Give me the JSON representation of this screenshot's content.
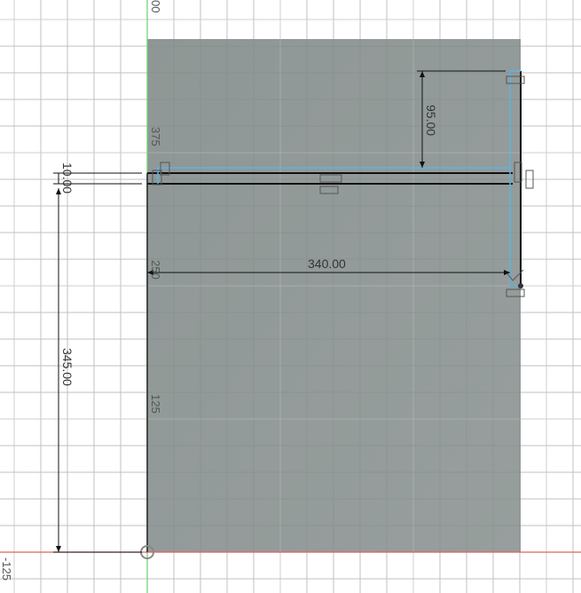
{
  "viewport": {
    "axis_labels": {
      "top": "00",
      "v375": "375",
      "v250": "250",
      "v125": "125",
      "neg125": "-125"
    }
  },
  "dimensions": {
    "thickness": "10.00",
    "offset_top": "95.00",
    "width": "340.00",
    "height": "345.00"
  },
  "colors": {
    "profile": "#929a99",
    "selected": "#5ab4e6",
    "x_axis": "#e06060",
    "y_axis": "#6ccf6c",
    "grid": "#e4e4e4"
  }
}
